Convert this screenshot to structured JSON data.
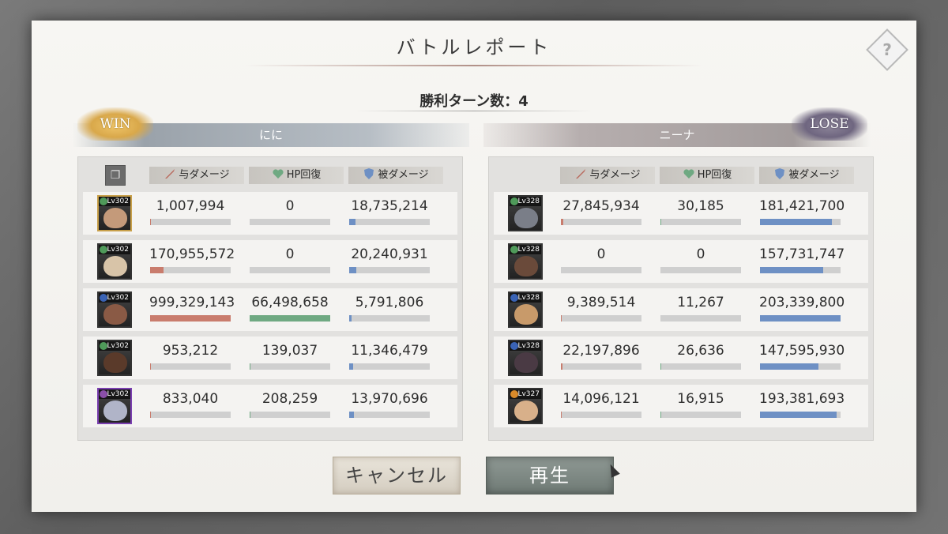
{
  "dialog": {
    "title": "バトルレポート",
    "help_label": "?",
    "turn_text": "勝利ターン数：4"
  },
  "left": {
    "result": "WIN",
    "player": "にに",
    "headers": {
      "damage": "与ダメージ",
      "heal": "HP回復",
      "taken": "被ダメージ"
    },
    "units": [
      {
        "level": "Lv302",
        "element_color": "#4f9a5a",
        "face_color": "#c49a7a",
        "frame_color": "#c8a04a",
        "damage": "1,007,994",
        "heal": "0",
        "taken": "18,735,214",
        "damage_fill": 0.01,
        "heal_fill": 0.0,
        "taken_fill": 0.08
      },
      {
        "level": "Lv302",
        "element_color": "#4f9a5a",
        "face_color": "#d8c4a8",
        "frame_color": "#333333",
        "damage": "170,955,572",
        "heal": "0",
        "taken": "20,240,931",
        "damage_fill": 0.17,
        "heal_fill": 0.0,
        "taken_fill": 0.09
      },
      {
        "level": "Lv302",
        "element_color": "#3a63b5",
        "face_color": "#8a5a45",
        "frame_color": "#333333",
        "damage": "999,329,143",
        "heal": "66,498,658",
        "taken": "5,791,806",
        "damage_fill": 1.0,
        "heal_fill": 1.0,
        "taken_fill": 0.03
      },
      {
        "level": "Lv302",
        "element_color": "#4f9a5a",
        "face_color": "#5a3a2a",
        "frame_color": "#333333",
        "damage": "953,212",
        "heal": "139,037",
        "taken": "11,346,479",
        "damage_fill": 0.01,
        "heal_fill": 0.01,
        "taken_fill": 0.05
      },
      {
        "level": "Lv302",
        "element_color": "#8a4fa8",
        "face_color": "#b0b4c8",
        "frame_color": "#7a3fb0",
        "damage": "833,040",
        "heal": "208,259",
        "taken": "13,970,696",
        "damage_fill": 0.01,
        "heal_fill": 0.01,
        "taken_fill": 0.06
      }
    ]
  },
  "right": {
    "result": "LOSE",
    "player": "ニーナ",
    "headers": {
      "damage": "与ダメージ",
      "heal": "HP回復",
      "taken": "被ダメージ"
    },
    "units": [
      {
        "level": "Lv328",
        "element_color": "#4f9a5a",
        "face_color": "#7a7e88",
        "frame_color": "#333333",
        "damage": "27,845,934",
        "heal": "30,185",
        "taken": "181,421,700",
        "damage_fill": 0.03,
        "heal_fill": 0.01,
        "taken_fill": 0.89
      },
      {
        "level": "Lv328",
        "element_color": "#4f9a5a",
        "face_color": "#6a4a3a",
        "frame_color": "#333333",
        "damage": "0",
        "heal": "0",
        "taken": "157,731,747",
        "damage_fill": 0.0,
        "heal_fill": 0.0,
        "taken_fill": 0.78
      },
      {
        "level": "Lv328",
        "element_color": "#3a63b5",
        "face_color": "#c89a6a",
        "frame_color": "#333333",
        "damage": "9,389,514",
        "heal": "11,267",
        "taken": "203,339,800",
        "damage_fill": 0.01,
        "heal_fill": 0.0,
        "taken_fill": 1.0
      },
      {
        "level": "Lv328",
        "element_color": "#3a63b5",
        "face_color": "#4a3a44",
        "frame_color": "#333333",
        "damage": "22,197,896",
        "heal": "26,636",
        "taken": "147,595,930",
        "damage_fill": 0.02,
        "heal_fill": 0.01,
        "taken_fill": 0.73
      },
      {
        "level": "Lv327",
        "element_color": "#d98a2a",
        "face_color": "#d8b08a",
        "frame_color": "#333333",
        "damage": "14,096,121",
        "heal": "16,915",
        "taken": "193,381,693",
        "damage_fill": 0.01,
        "heal_fill": 0.01,
        "taken_fill": 0.95
      }
    ]
  },
  "buttons": {
    "cancel": "キャンセル",
    "play": "再生"
  }
}
